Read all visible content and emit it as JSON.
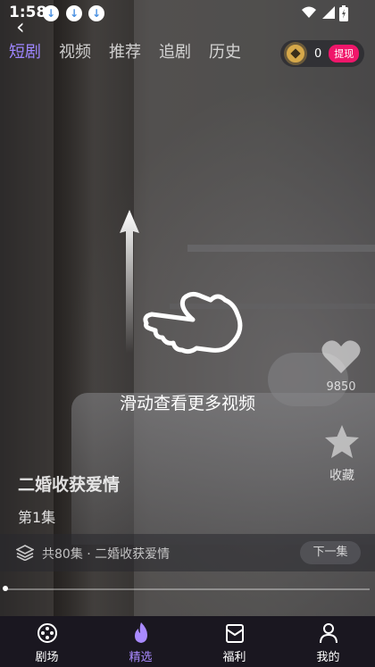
{
  "status_bar": {
    "time": "1:58"
  },
  "header": {
    "tabs": [
      {
        "label": "短剧",
        "active": true
      },
      {
        "label": "视频",
        "active": false
      },
      {
        "label": "推荐",
        "active": false
      },
      {
        "label": "追剧",
        "active": false
      },
      {
        "label": "历史",
        "active": false
      }
    ],
    "coins": {
      "count": "0",
      "withdraw_label": "提现"
    }
  },
  "overlay": {
    "hint": "滑动查看更多视频"
  },
  "side_actions": {
    "like_count": "9850",
    "collect_label": "收藏"
  },
  "drama": {
    "title": "二婚收获爱情",
    "episode": "第1集",
    "series_info": "共80集 · 二婚收获爱情",
    "next_label": "下一集"
  },
  "playback": {
    "progress": 0.0
  },
  "bottom_nav": [
    {
      "label": "剧场",
      "icon": "film-reel-icon",
      "active": false
    },
    {
      "label": "精选",
      "icon": "flame-icon",
      "active": true
    },
    {
      "label": "福利",
      "icon": "gift-box-icon",
      "active": false
    },
    {
      "label": "我的",
      "icon": "user-icon",
      "active": false
    }
  ],
  "colors": {
    "active_tab": "#9e86ff",
    "withdraw_badge": "#f0166a",
    "nav_active": "#a98aff",
    "nav_background": "#1a1720"
  }
}
